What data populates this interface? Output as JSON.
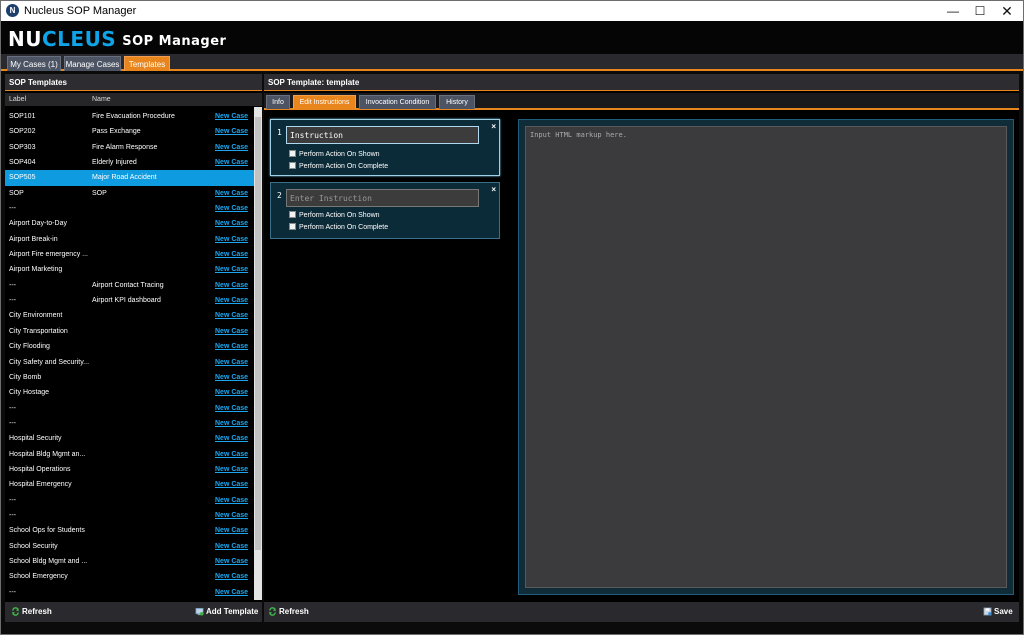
{
  "window": {
    "title": "Nucleus SOP Manager",
    "icon_letter": "N"
  },
  "brand": {
    "part1": "NU",
    "part2": "CLEUS",
    "subtitle": "SOP Manager"
  },
  "top_tabs": [
    {
      "label": "My Cases (1)"
    },
    {
      "label": "Manage Cases"
    },
    {
      "label": "Templates",
      "active": true
    }
  ],
  "left_panel": {
    "title": "SOP Templates",
    "col_label": "Label",
    "col_name": "Name",
    "rows": [
      {
        "label": "SOP101",
        "name": "Fire Evacuation Procedure",
        "action": "New Case"
      },
      {
        "label": "SOP202",
        "name": "Pass Exchange",
        "action": "New Case"
      },
      {
        "label": "SOP303",
        "name": "Fire Alarm Response",
        "action": "New Case"
      },
      {
        "label": "SOP404",
        "name": "Elderly Injured",
        "action": "New Case"
      },
      {
        "label": "SOP505",
        "name": "Major Road Accident",
        "action": "New Case",
        "selected": true
      },
      {
        "label": "SOP",
        "name": "SOP",
        "action": "New Case"
      },
      {
        "label": "---",
        "name": "",
        "action": "New Case"
      },
      {
        "label": "Airport Day-to-Day",
        "name": "",
        "action": "New Case"
      },
      {
        "label": "Airport Break-in",
        "name": "",
        "action": "New Case"
      },
      {
        "label": "Airport Fire emergency ...",
        "name": "",
        "action": "New Case"
      },
      {
        "label": "Airport Marketing",
        "name": "",
        "action": "New Case"
      },
      {
        "label": "---",
        "name": "Airport Contact Tracing",
        "action": "New Case"
      },
      {
        "label": "---",
        "name": "Airport KPI dashboard",
        "action": "New Case"
      },
      {
        "label": "City Environment",
        "name": "",
        "action": "New Case"
      },
      {
        "label": "City Transportation",
        "name": "",
        "action": "New Case"
      },
      {
        "label": "City Flooding",
        "name": "",
        "action": "New Case"
      },
      {
        "label": "City Safety and Security...",
        "name": "",
        "action": "New Case"
      },
      {
        "label": "City Bomb",
        "name": "",
        "action": "New Case"
      },
      {
        "label": "City Hostage",
        "name": "",
        "action": "New Case"
      },
      {
        "label": "---",
        "name": "",
        "action": "New Case"
      },
      {
        "label": "---",
        "name": "",
        "action": "New Case"
      },
      {
        "label": "Hospital Security",
        "name": "",
        "action": "New Case"
      },
      {
        "label": "Hospital Bldg Mgmt an...",
        "name": "",
        "action": "New Case"
      },
      {
        "label": "Hospital Operations",
        "name": "",
        "action": "New Case"
      },
      {
        "label": "Hospital Emergency",
        "name": "",
        "action": "New Case"
      },
      {
        "label": "---",
        "name": "",
        "action": "New Case"
      },
      {
        "label": "---",
        "name": "",
        "action": "New Case"
      },
      {
        "label": "School Ops for Students",
        "name": "",
        "action": "New Case"
      },
      {
        "label": "School Security",
        "name": "",
        "action": "New Case"
      },
      {
        "label": "School Bldg Mgmt and ...",
        "name": "",
        "action": "New Case"
      },
      {
        "label": "School Emergency",
        "name": "",
        "action": "New Case"
      },
      {
        "label": "---",
        "name": "",
        "action": "New Case"
      }
    ],
    "refresh_label": "Refresh",
    "add_template_label": "Add Template"
  },
  "right_panel": {
    "title": "SOP Template: template",
    "tabs": [
      {
        "label": "Info"
      },
      {
        "label": "Edit Instructions",
        "active": true
      },
      {
        "label": "Invocation Condition"
      },
      {
        "label": "History"
      }
    ],
    "instructions": [
      {
        "number": "1",
        "value": "Instruction",
        "placeholder": "Enter Instruction",
        "opt_shown": "Perform Action On Shown",
        "opt_complete": "Perform Action On Complete"
      },
      {
        "number": "2",
        "value": "",
        "placeholder": "Enter Instruction",
        "opt_shown": "Perform Action On Shown",
        "opt_complete": "Perform Action On Complete"
      }
    ],
    "close_glyph": "×",
    "editor_placeholder": "Input HTML markup here.",
    "refresh_label": "Refresh",
    "save_label": "Save"
  },
  "colors": {
    "accent": "#e8851c",
    "brand_blue": "#0fa3e8",
    "selection": "#0f9be0",
    "link": "#1da6ee"
  }
}
